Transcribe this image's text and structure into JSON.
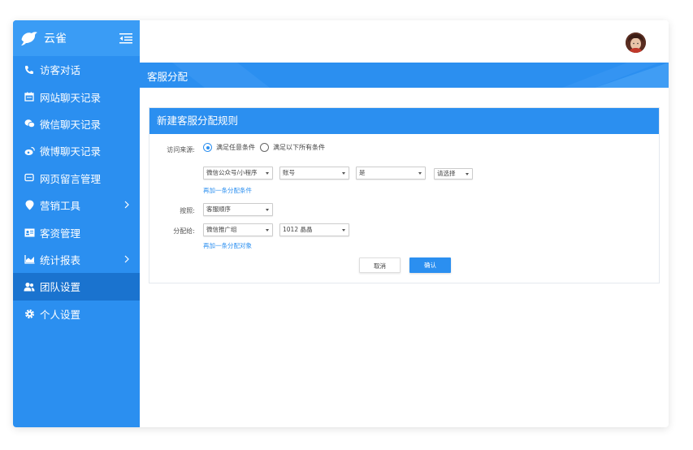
{
  "app": {
    "name": "云雀"
  },
  "sidebar": {
    "items": [
      {
        "label": "访客对话",
        "icon": "phone-chat-icon",
        "chevron": false,
        "active": false
      },
      {
        "label": "网站聊天记录",
        "icon": "calendar-icon",
        "chevron": false,
        "active": false
      },
      {
        "label": "微信聊天记录",
        "icon": "wechat-icon",
        "chevron": false,
        "active": false
      },
      {
        "label": "微博聊天记录",
        "icon": "weibo-icon",
        "chevron": false,
        "active": false
      },
      {
        "label": "网页留言管理",
        "icon": "message-icon",
        "chevron": false,
        "active": false
      },
      {
        "label": "营销工具",
        "icon": "location-pin-icon",
        "chevron": true,
        "active": false
      },
      {
        "label": "客资管理",
        "icon": "contact-card-icon",
        "chevron": false,
        "active": false
      },
      {
        "label": "统计报表",
        "icon": "chart-icon",
        "chevron": true,
        "active": false
      },
      {
        "label": "团队设置",
        "icon": "team-icon",
        "chevron": false,
        "active": true
      },
      {
        "label": "个人设置",
        "icon": "gear-icon",
        "chevron": false,
        "active": false
      }
    ]
  },
  "page": {
    "title": "客服分配"
  },
  "form": {
    "title": "新建客服分配规则",
    "source_label": "访问来源:",
    "radio_any": "满足任意条件",
    "radio_all": "满足以下所有条件",
    "cond_channel": "微信公众号/小程序",
    "cond_field": "账号",
    "cond_op": "是",
    "cond_value": "请选择",
    "add_condition": "再加一条分配条件",
    "by_label": "按照:",
    "by_value": "客服顺序",
    "assign_label": "分配给:",
    "assign_group": "微信推广组",
    "assign_agent": "1012 晶晶",
    "add_target": "再加一条分配对象",
    "cancel": "取消",
    "confirm": "确认"
  },
  "colors": {
    "primary": "#2b8ff0",
    "primary_dark": "#1a73cf"
  }
}
